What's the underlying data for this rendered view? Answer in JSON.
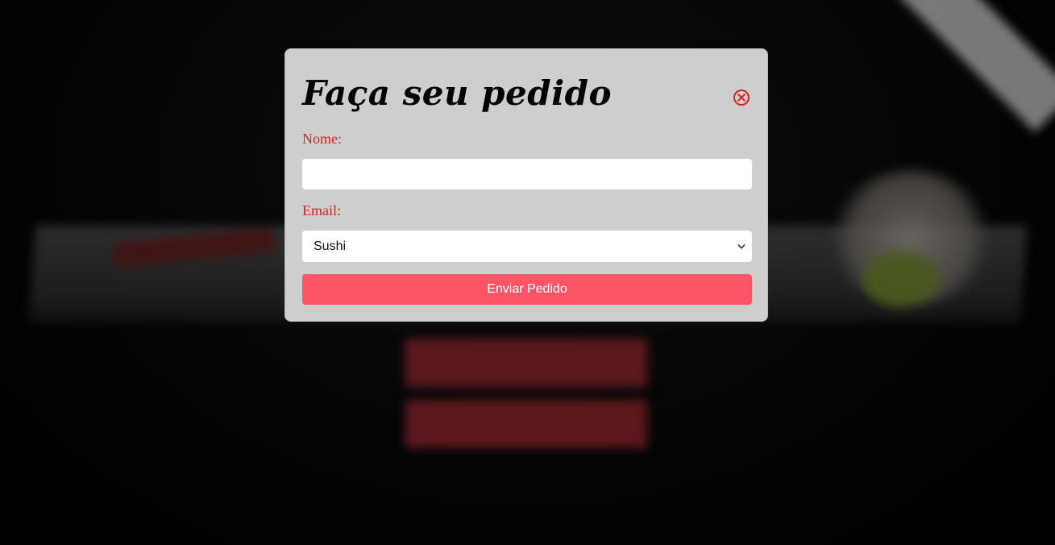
{
  "modal": {
    "title": "Faça seu pedido",
    "close_icon": "close-circle-icon",
    "accent_color": "#e01f1f",
    "nome_label": "Nome:",
    "nome_value": "",
    "email_label": "Email:",
    "select_value": "Sushi",
    "select_icon": "chevron-down-icon",
    "submit_label": "Enviar Pedido",
    "submit_color": "#ff5465"
  }
}
